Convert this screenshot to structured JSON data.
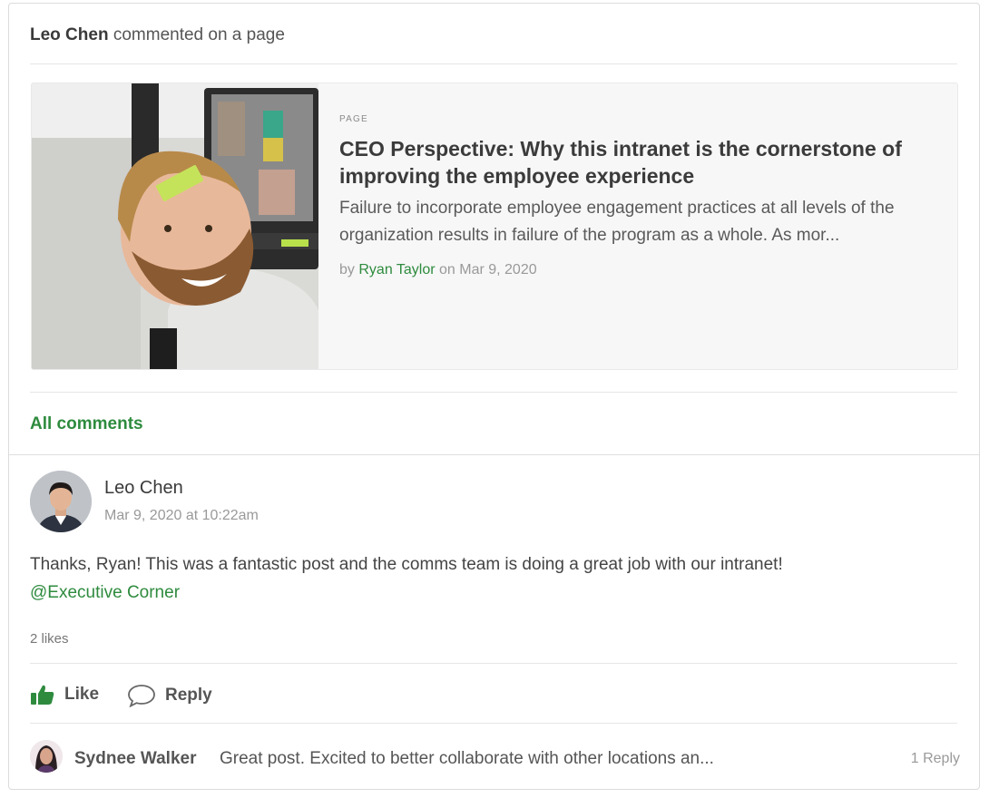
{
  "activity": {
    "actor": "Leo Chen",
    "action": "commented on a page"
  },
  "page": {
    "kicker": "PAGE",
    "title": "CEO Perspective: Why this intranet is the cornerstone of improving the employee experience",
    "excerpt": "Failure to incorporate employee engagement practices at all levels of the organization results in failure of the program as a whole.  As mor...",
    "by_prefix": "by",
    "author": "Ryan Taylor",
    "date_text": "on Mar 9, 2020",
    "thumbnail_icon": "smiling-man-photo"
  },
  "all_comments_label": "All comments",
  "comment": {
    "author": "Leo Chen",
    "timestamp": "Mar 9, 2020 at 10:22am",
    "text": "Thanks, Ryan!  This was a fantastic post and the comms team is doing a great job with our intranet!",
    "mention": "@Executive Corner",
    "likes": "2 likes",
    "avatar_icon": "leo-chen-avatar"
  },
  "actions": {
    "like_label": "Like",
    "reply_label": "Reply"
  },
  "reply": {
    "author": "Sydnee Walker",
    "text": "Great post.  Excited to better collaborate with other locations an...",
    "count": "1 Reply"
  },
  "colors": {
    "accent_green": "#2e8b3e",
    "muted_text": "#999999"
  }
}
